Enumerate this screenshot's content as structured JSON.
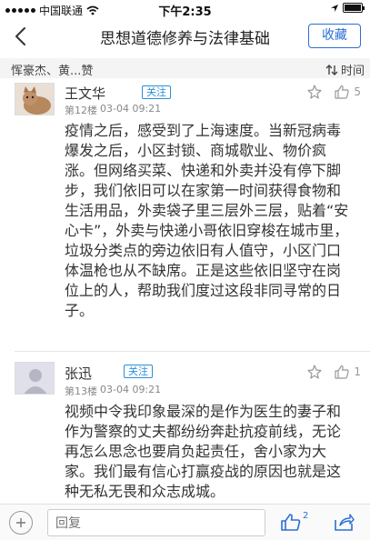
{
  "status_bar": {
    "carrier": "中国联通",
    "time": "下午2:35"
  },
  "nav": {
    "title": "思想道德修养与法律基础",
    "favorite_label": "收藏"
  },
  "likes_bar": {
    "names": "恽豪杰、黄...赞",
    "sort_label": "时间"
  },
  "comments": [
    {
      "username": "王文华",
      "follow_label": "关注",
      "floor": "第12楼",
      "time": "03-04 09:21",
      "likes": "5",
      "text": "疫情之后，感受到了上海速度。当新冠病毒爆发之后，小区封锁、商城歇业、物价疯涨。但网络买菜、快递和外卖并没有停下脚步，我们依旧可以在家第一时间获得食物和生活用品，外卖袋子里三层外三层，贴着“安心卡”，外卖与快递小哥依旧穿梭在城市里，垃圾分类点的旁边依旧有人值守，小区门口体温枪也从不缺席。正是这些依旧坚守在岗位上的人，帮助我们度过这段非同寻常的日子。"
    },
    {
      "username": "张迅",
      "follow_label": "关注",
      "floor": "第13楼",
      "time": "03-04 09:21",
      "likes": "1",
      "text": "视频中令我印象最深的是作为医生的妻子和作为警察的丈夫都纷纷奔赴抗疫前线，无论再怎么思念也要肩负起责任，舍小家为大家。我们最有信心打赢疫战的原因也就是这种无私无畏和众志成城。"
    }
  ],
  "bottom_bar": {
    "reply_placeholder": "回复",
    "like_count": "2"
  }
}
